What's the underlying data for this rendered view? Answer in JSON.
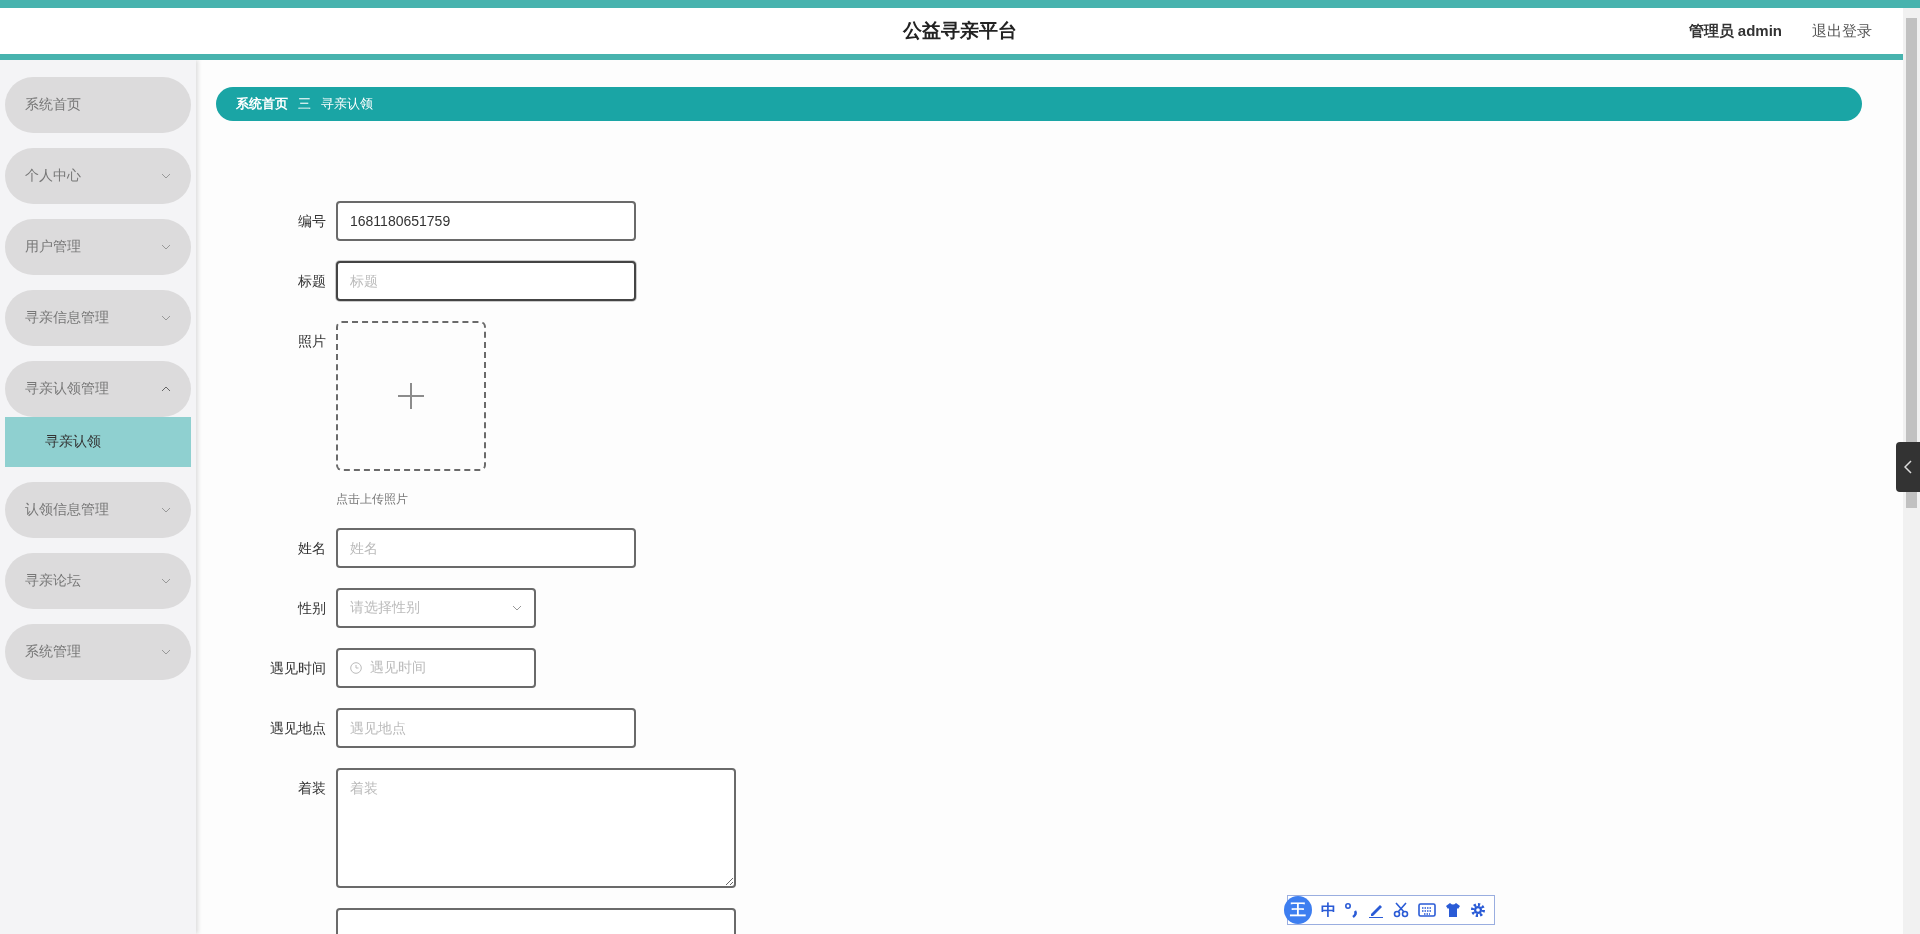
{
  "header": {
    "title": "公益寻亲平台",
    "user": "管理员 admin",
    "logout": "退出登录"
  },
  "sidebar": {
    "items": [
      {
        "label": "系统首页"
      },
      {
        "label": "个人中心",
        "expanded": false
      },
      {
        "label": "用户管理",
        "expanded": false
      },
      {
        "label": "寻亲信息管理",
        "expanded": false
      },
      {
        "label": "寻亲认领管理",
        "expanded": true,
        "children": [
          {
            "label": "寻亲认领",
            "selected": true
          }
        ]
      },
      {
        "label": "认领信息管理",
        "expanded": false
      },
      {
        "label": "寻亲论坛",
        "expanded": false
      },
      {
        "label": "系统管理",
        "expanded": false
      }
    ]
  },
  "breadcrumb": {
    "home": "系统首页",
    "separator": "三",
    "current": "寻亲认领"
  },
  "form": {
    "fields": [
      {
        "kind": "text",
        "label": "编号",
        "value": "1681180651759"
      },
      {
        "kind": "text",
        "label": "标题",
        "placeholder": "标题",
        "focused": true
      },
      {
        "kind": "upload",
        "label": "照片",
        "hint": "点击上传照片"
      },
      {
        "kind": "text",
        "label": "姓名",
        "placeholder": "姓名"
      },
      {
        "kind": "select",
        "label": "性别",
        "placeholder": "请选择性别"
      },
      {
        "kind": "date",
        "label": "遇见时间",
        "placeholder": "遇见时间"
      },
      {
        "kind": "text",
        "label": "遇见地点",
        "placeholder": "遇见地点"
      },
      {
        "kind": "textarea",
        "label": "着装",
        "placeholder": "着装"
      },
      {
        "kind": "partial"
      }
    ]
  },
  "ime_toolbar": {
    "logo": "王",
    "mode": "中"
  }
}
